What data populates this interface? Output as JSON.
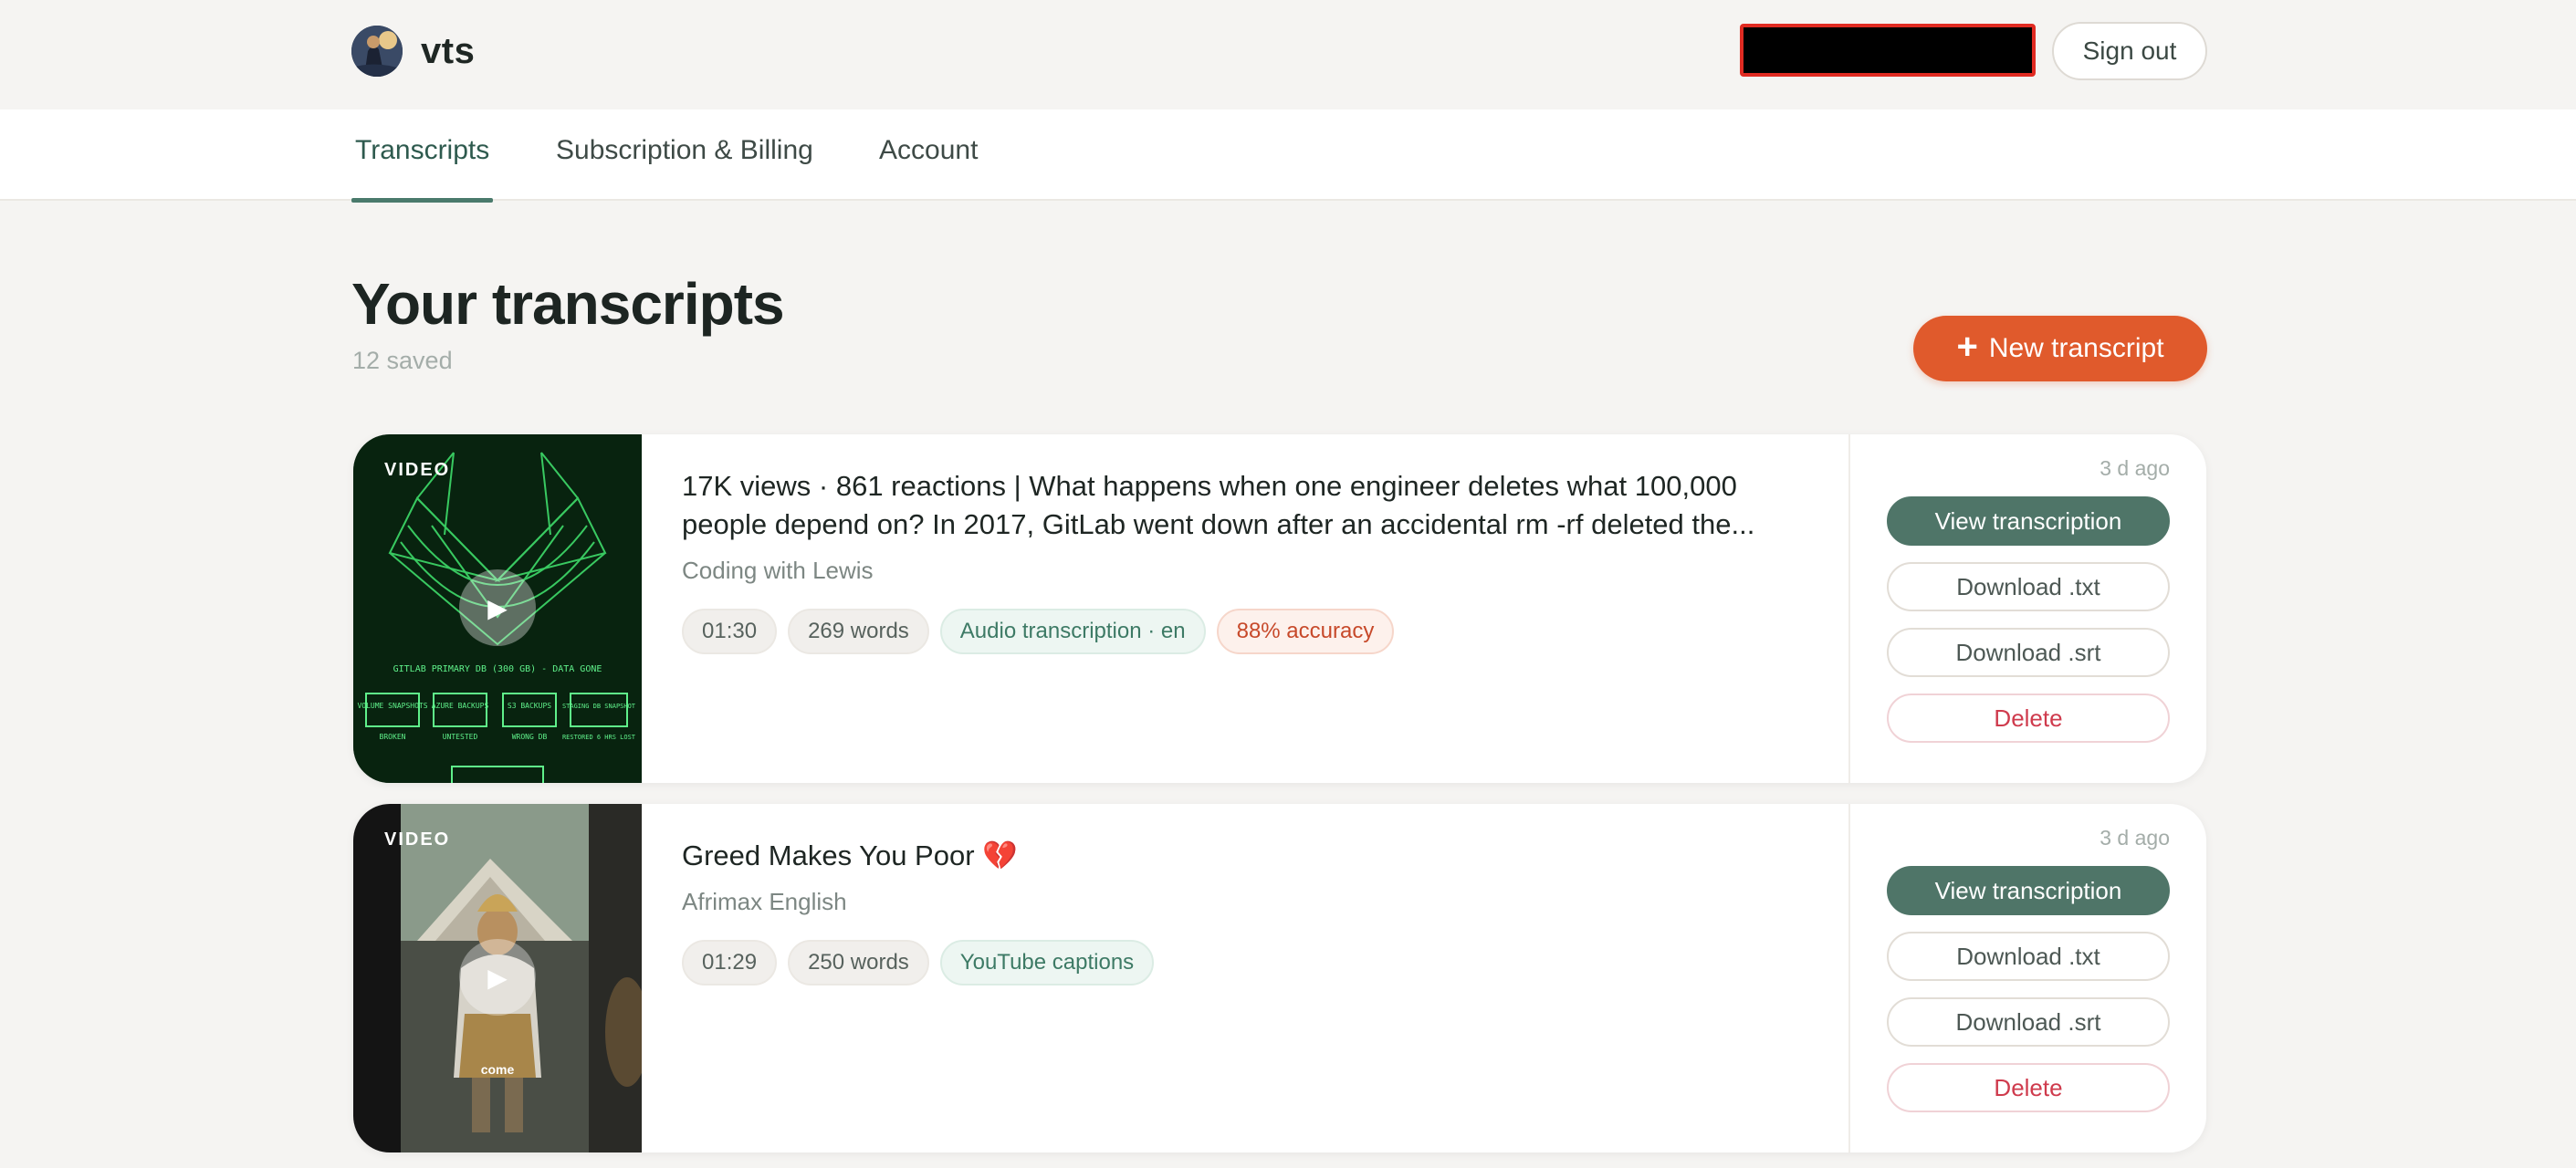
{
  "header": {
    "brand": "vts",
    "signout_label": "Sign out"
  },
  "tabs": [
    {
      "label": "Transcripts"
    },
    {
      "label": "Subscription & Billing"
    },
    {
      "label": "Account"
    }
  ],
  "main": {
    "title": "Your transcripts",
    "subtitle": "12 saved",
    "new_button_label": "New transcript"
  },
  "items": [
    {
      "badge": "VIDEO",
      "title": "17K views · 861 reactions | What happens when one engineer deletes what 100,000 people depend on? In 2017, GitLab went down after an accidental rm -rf deleted the...",
      "channel": "Coding with Lewis",
      "duration": "01:30",
      "words": "269 words",
      "source": "Audio transcription · en",
      "accuracy": "88% accuracy",
      "ago": "3 d ago",
      "thumb_text": {
        "headline": "GITLAB PRIMARY DB (300 GB) - DATA GONE",
        "boxes": [
          {
            "title": "VOLUME SNAPSHOTS",
            "status": "BROKEN"
          },
          {
            "title": "AZURE BACKUPS",
            "status": "UNTESTED"
          },
          {
            "title": "S3 BACKUPS",
            "status": "WRONG DB"
          },
          {
            "title": "STAGING DB SNAPSHOT",
            "status": "RESTORED 6 HRS LOST"
          }
        ]
      }
    },
    {
      "badge": "VIDEO",
      "title": "Greed Makes You Poor 💔",
      "channel": "Afrimax English",
      "duration": "01:29",
      "words": "250 words",
      "source": "YouTube captions",
      "ago": "3 d ago",
      "thumb_caption": "come"
    }
  ],
  "actions": {
    "view": "View transcription",
    "download_txt": "Download .txt",
    "download_srt": "Download .srt",
    "delete": "Delete"
  },
  "colors": {
    "accent": "#e05a2c",
    "primary": "#4f7568",
    "danger": "#cf3b4d"
  }
}
